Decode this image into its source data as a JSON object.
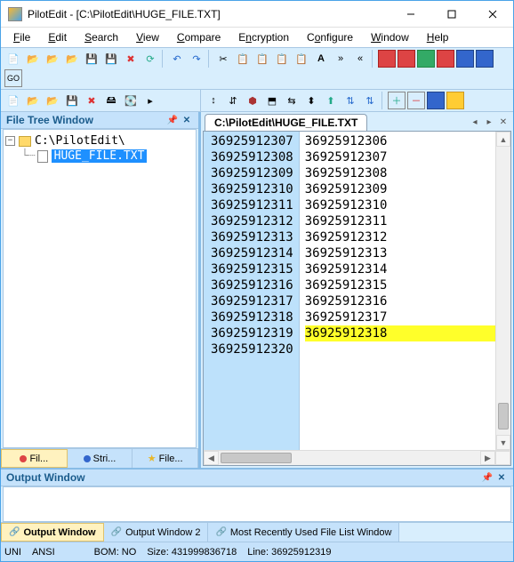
{
  "title": "PilotEdit - [C:\\PilotEdit\\HUGE_FILE.TXT]",
  "menus": [
    "File",
    "Edit",
    "Search",
    "View",
    "Compare",
    "Encryption",
    "Configure",
    "Window",
    "Help"
  ],
  "file_tree": {
    "header": "File Tree Window",
    "root": "C:\\PilotEdit\\",
    "file": "HUGE_FILE.TXT",
    "tabs": [
      "Fil...",
      "Stri...",
      "File..."
    ]
  },
  "document": {
    "tab_title": "C:\\PilotEdit\\HUGE_FILE.TXT",
    "gutter": [
      "36925912307",
      "36925912308",
      "36925912309",
      "36925912310",
      "36925912311",
      "36925912312",
      "36925912313",
      "36925912314",
      "36925912315",
      "36925912316",
      "36925912317",
      "36925912318",
      "36925912319",
      "36925912320"
    ],
    "content": [
      "36925912306",
      "36925912307",
      "36925912308",
      "36925912309",
      "36925912310",
      "36925912311",
      "36925912312",
      "36925912313",
      "36925912314",
      "36925912315",
      "36925912316",
      "36925912317",
      "36925912318",
      ""
    ],
    "highlight_index": 12
  },
  "output": {
    "header": "Output Window",
    "tabs": [
      "Output Window",
      "Output Window 2",
      "Most Recently Used File List Window"
    ]
  },
  "status": {
    "enc1": "UNI",
    "enc2": "ANSI",
    "bom": "BOM: NO",
    "size": "Size: 431999836718",
    "line": "Line: 36925912319"
  }
}
